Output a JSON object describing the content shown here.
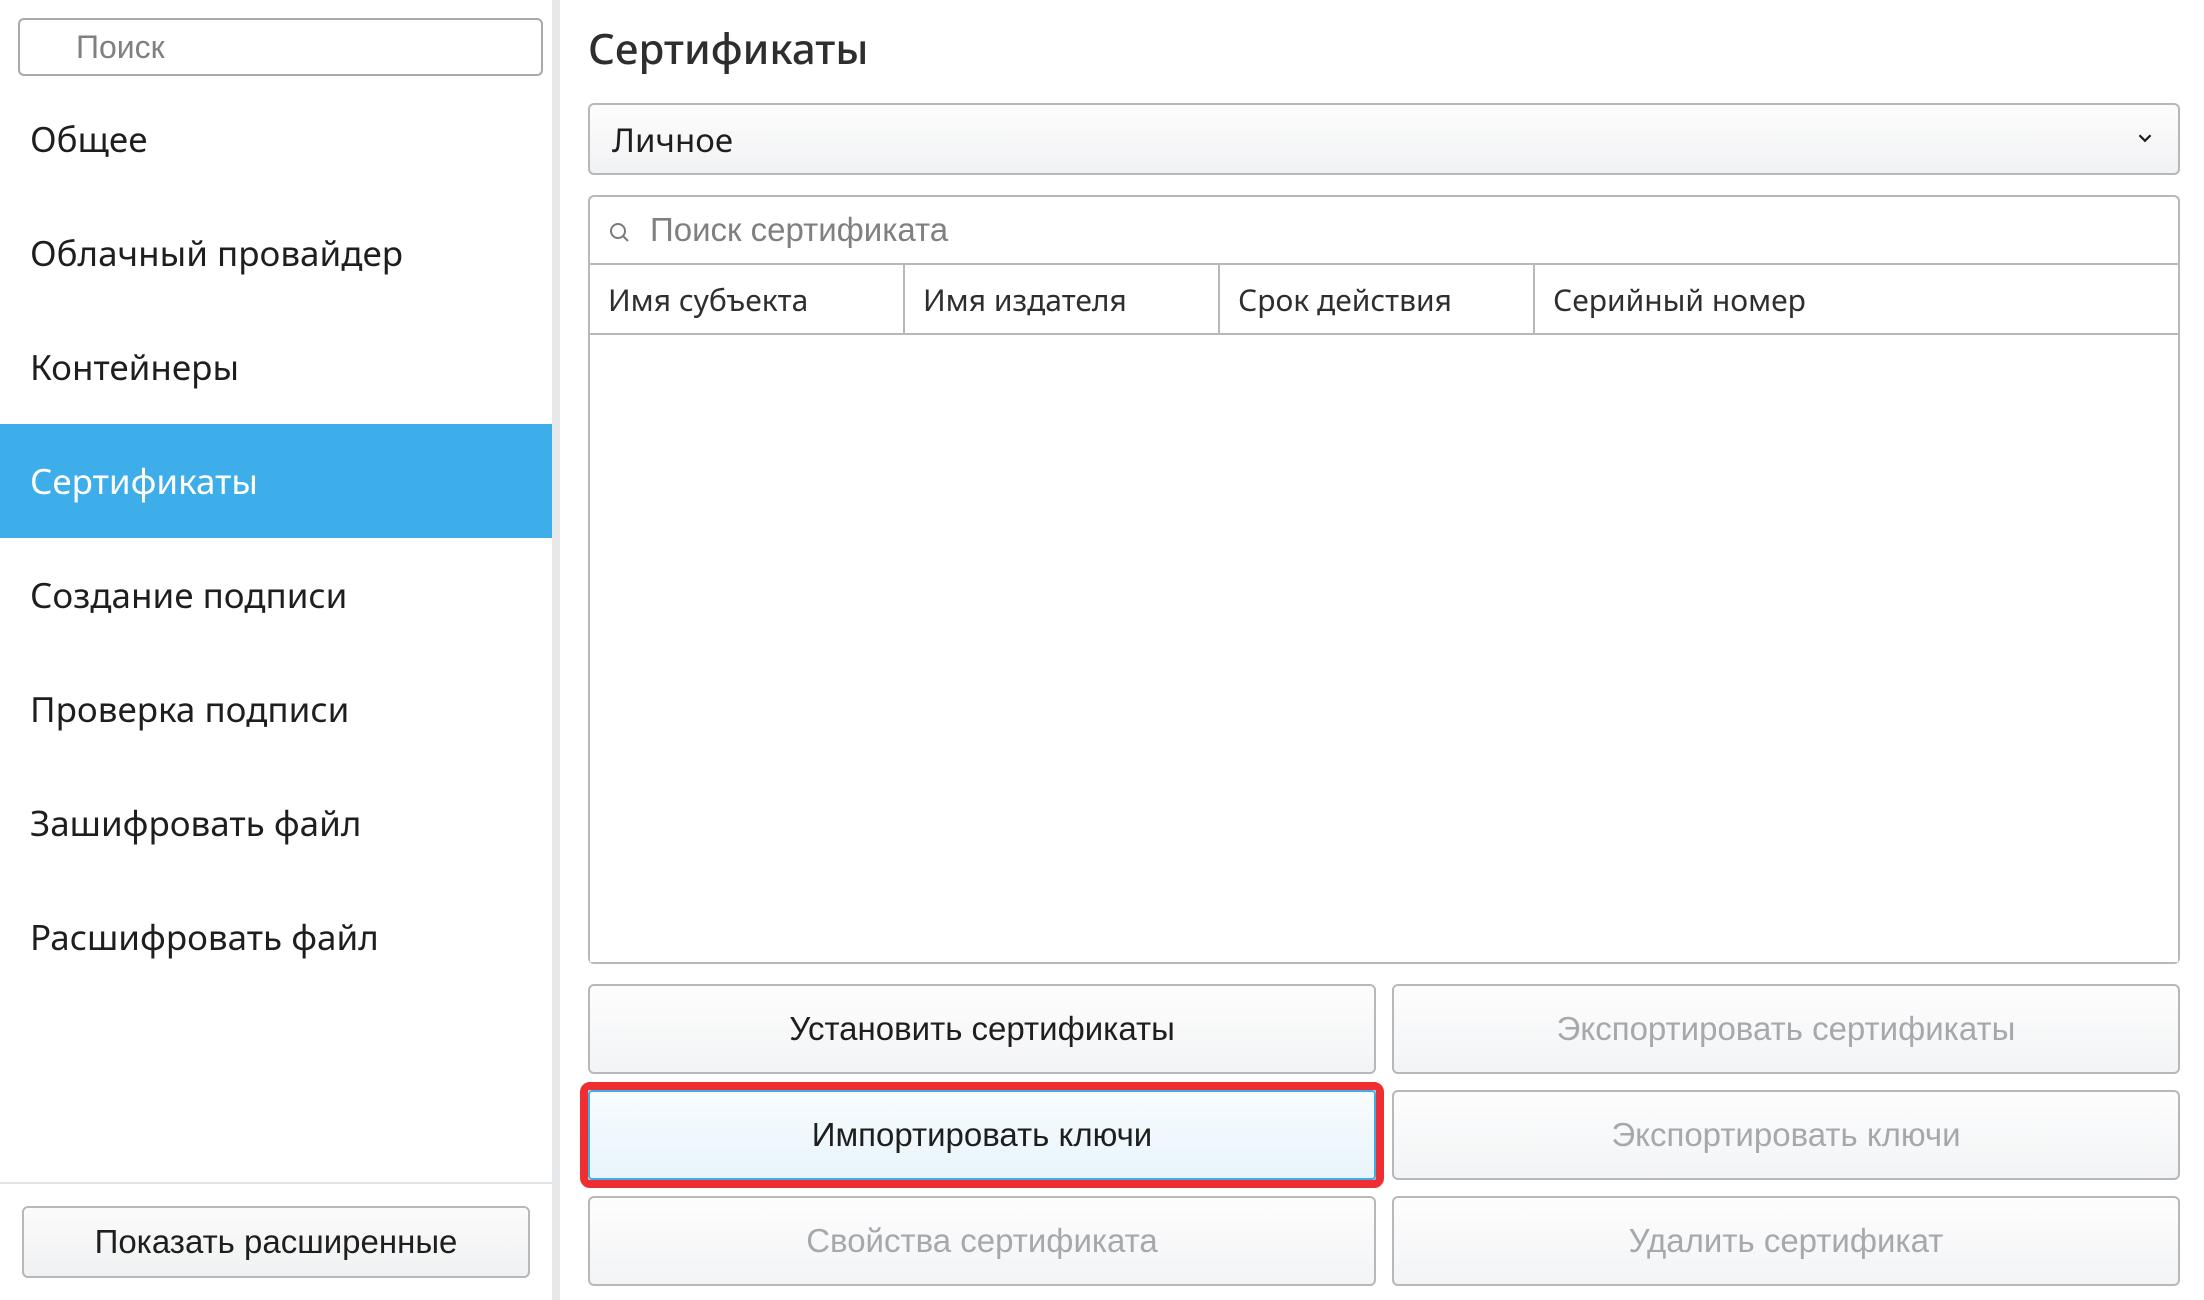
{
  "sidebar": {
    "search_placeholder": "Поиск",
    "items": [
      {
        "label": "Общее"
      },
      {
        "label": "Облачный провайдер"
      },
      {
        "label": "Контейнеры"
      },
      {
        "label": "Сертификаты"
      },
      {
        "label": "Создание подписи"
      },
      {
        "label": "Проверка подписи"
      },
      {
        "label": "Зашифровать файл"
      },
      {
        "label": "Расшифровать файл"
      }
    ],
    "active_index": 3,
    "advanced_button": "Показать расширенные"
  },
  "main": {
    "title": "Сертификаты",
    "store_dropdown": {
      "selected": "Личное"
    },
    "cert_search_placeholder": "Поиск сертификата",
    "table": {
      "columns": [
        "Имя субъекта",
        "Имя издателя",
        "Срок действия",
        "Серийный номер"
      ],
      "rows": []
    },
    "buttons": {
      "install": "Установить сертификаты",
      "export_certs": "Экспортировать сертификаты",
      "import_keys": "Импортировать ключи",
      "export_keys": "Экспортировать ключи",
      "cert_props": "Свойства сертификата",
      "delete_cert": "Удалить сертификат"
    }
  }
}
